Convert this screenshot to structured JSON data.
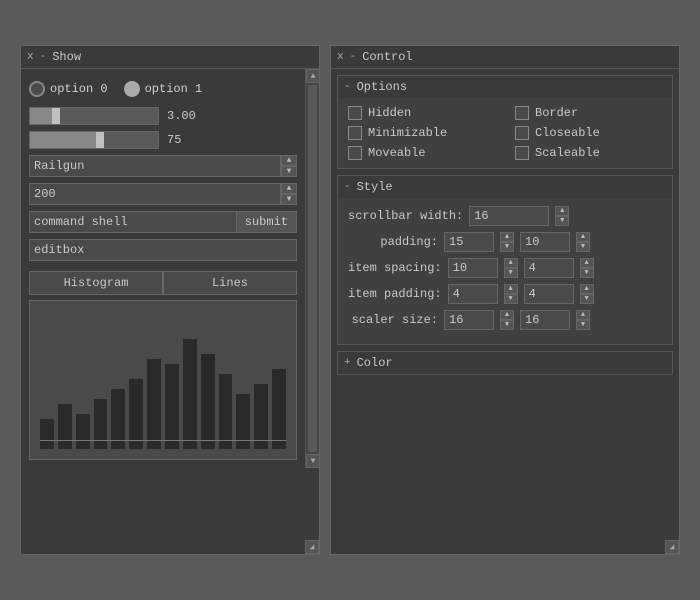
{
  "left_panel": {
    "x_label": "x",
    "dash_label": "-",
    "title": "Show",
    "option0": {
      "label": "option 0"
    },
    "option1": {
      "label": "option 1"
    },
    "slider1": {
      "value": "3.00",
      "fill_pct": 20
    },
    "slider2": {
      "value": "75",
      "fill_pct": 55
    },
    "dropdown": {
      "value": "Railgun"
    },
    "number_input": {
      "value": "200"
    },
    "cmd_input": {
      "value": "command shell",
      "submit_label": "submit"
    },
    "editbox": {
      "value": "editbox"
    },
    "tab_histogram": "Histogram",
    "tab_lines": "Lines",
    "histogram_bars": [
      30,
      45,
      35,
      50,
      60,
      70,
      90,
      85,
      110,
      95,
      75,
      55,
      65,
      80
    ]
  },
  "right_panel": {
    "x_label": "x",
    "dash_label": "-",
    "title": "Control",
    "options_section": {
      "toggle": "-",
      "title": "Options",
      "hidden": "Hidden",
      "border": "Border",
      "minimizable": "Minimizable",
      "closeable": "Closeable",
      "moveable": "Moveable",
      "scaleable": "Scaleable"
    },
    "style_section": {
      "toggle": "-",
      "title": "Style",
      "scrollbar_width_label": "scrollbar width:",
      "scrollbar_width_value": "16",
      "padding_label": "padding:",
      "padding_v": "15",
      "padding_h": "10",
      "item_spacing_label": "item spacing:",
      "item_spacing_v": "10",
      "item_spacing_h": "4",
      "item_padding_label": "item padding:",
      "item_padding_v": "4",
      "item_padding_h": "4",
      "scaler_size_label": "scaler size:",
      "scaler_size_v": "16",
      "scaler_size_h": "16"
    },
    "color_section": {
      "toggle": "+",
      "title": "Color"
    }
  }
}
